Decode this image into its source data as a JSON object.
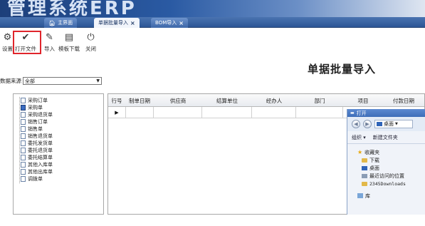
{
  "banner": {
    "title": "管理系统ERP"
  },
  "tabs": [
    {
      "label": "主界面",
      "close": ""
    },
    {
      "label": "单据批量导入",
      "close": "×"
    },
    {
      "label": "BOM导入",
      "close": "×"
    }
  ],
  "toolbar": {
    "settings": "设置",
    "open_file": "打开文件",
    "import": "导入",
    "template_download": "模板下载",
    "close": "关闭"
  },
  "page_title": "单据批量导入",
  "source": {
    "label": "数据来源",
    "value": "全部"
  },
  "tree": {
    "items": [
      "采购订单",
      "采购单",
      "采购退货单",
      "销售订单",
      "销售单",
      "销售退货单",
      "委托发货单",
      "委托退货单",
      "委托结算单",
      "其他入库单",
      "其他出库单",
      "调拨单"
    ]
  },
  "table": {
    "headers": [
      "行号",
      "制单日期",
      "供应商",
      "结算单位",
      "经办人",
      "部门",
      "项目",
      "付款日期"
    ],
    "row_indicator": "▶"
  },
  "dialog": {
    "title": "打开",
    "address": "桌面",
    "organize": "组织 ▾",
    "new_folder": "新建文件夹",
    "items": [
      {
        "label": "收藏夹",
        "icon": "star-icon",
        "child": false
      },
      {
        "label": "下载",
        "icon": "folder-icon",
        "child": true
      },
      {
        "label": "桌面",
        "icon": "desktop-icon",
        "child": true
      },
      {
        "label": "最近访问的位置",
        "icon": "recent-icon",
        "child": true
      },
      {
        "label": "2345Downloads",
        "icon": "folder-icon",
        "child": true
      },
      {
        "label": "库",
        "icon": "library-icon",
        "child": false
      }
    ]
  }
}
